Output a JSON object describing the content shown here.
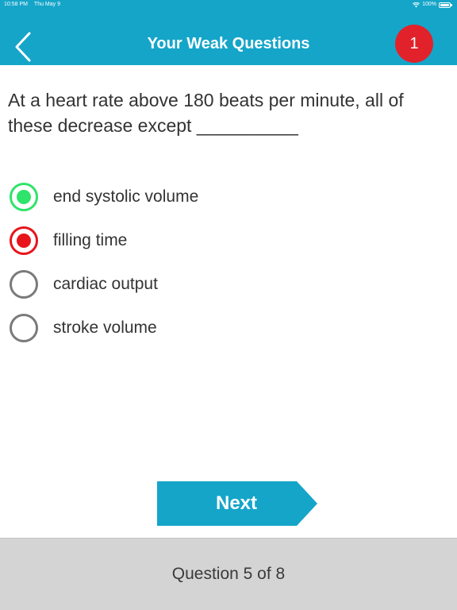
{
  "status_bar": {
    "time": "10:58 PM",
    "date": "Thu May 9",
    "battery": "100%"
  },
  "header": {
    "back_icon": "chevron-left-icon",
    "title": "Your Weak Questions",
    "badge_count": "1"
  },
  "question": {
    "text": "At a heart rate above 180 beats per minute, all of these decrease except __________"
  },
  "options": [
    {
      "label": "end systolic volume",
      "state": "correct"
    },
    {
      "label": "filling time",
      "state": "incorrect-selected"
    },
    {
      "label": "cardiac output",
      "state": "unselected"
    },
    {
      "label": "stroke volume",
      "state": "unselected"
    }
  ],
  "actions": {
    "next_label": "Next"
  },
  "footer": {
    "counter": "Question 5 of 8"
  },
  "colors": {
    "header": "#15a5c9",
    "badge": "#e1222a",
    "correct": "#2fe46a",
    "incorrect": "#e8141c",
    "unselected": "#7a7a7a",
    "footer": "#d4d4d4"
  }
}
